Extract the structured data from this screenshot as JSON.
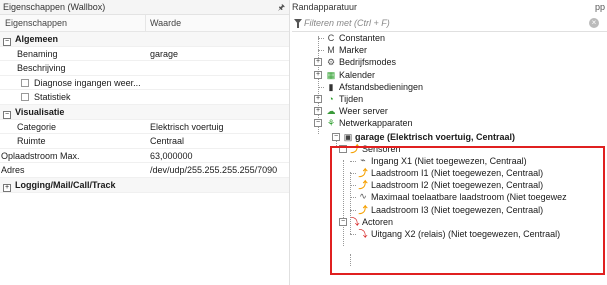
{
  "left_panel": {
    "title": "Eigenschappen (Wallbox)",
    "pin_icon": "pin-icon",
    "col_name": "Eigenschappen",
    "col_value": "Waarde",
    "sections": {
      "algemeen": "Algemeen",
      "visualisatie": "Visualisatie",
      "logging": "Logging/Mail/Call/Track"
    },
    "rows": {
      "benaming_k": "Benaming",
      "benaming_v": "garage",
      "beschrijving_k": "Beschrijving",
      "diagnose_k": "Diagnose ingangen weer...",
      "statistiek_k": "Statistiek",
      "categorie_k": "Categorie",
      "categorie_v": "Elektrisch voertuig",
      "ruimte_k": "Ruimte",
      "ruimte_v": "Centraal",
      "opl_k": "Oplaadstroom Max.",
      "opl_v": "63,000000",
      "adres_k": "Adres",
      "adres_v": "/dev/udp/255.255.255.255/7090"
    }
  },
  "right_panel": {
    "title": "Randapparatuur",
    "corner": "pp",
    "filter_placeholder": "Filteren met (Ctrl + F)",
    "tree": {
      "constanten": "Constanten",
      "marker": "Marker",
      "bedrijfsmodes": "Bedrijfsmodes",
      "kalender": "Kalender",
      "afstand": "Afstandsbedieningen",
      "tijden": "Tijden",
      "weer": "Weer server",
      "netwerk": "Netwerkapparaten",
      "garage": "garage (Elektrisch voertuig, Centraal)",
      "sensoren": "Sensoren",
      "s1": "Ingang X1 (Niet toegewezen, Centraal)",
      "s2": "Laadstroom I1 (Niet toegewezen, Centraal)",
      "s3": "Laadstroom I2 (Niet toegewezen, Centraal)",
      "s4": "Maximaal toelaatbare laadstroom (Niet toegewez",
      "s5": "Laadstroom I3 (Niet toegewezen, Centraal)",
      "actoren": "Actoren",
      "a1": "Uitgang X2 (relais) (Niet toegewezen, Centraal)"
    },
    "highlight_color": "#e02020"
  }
}
